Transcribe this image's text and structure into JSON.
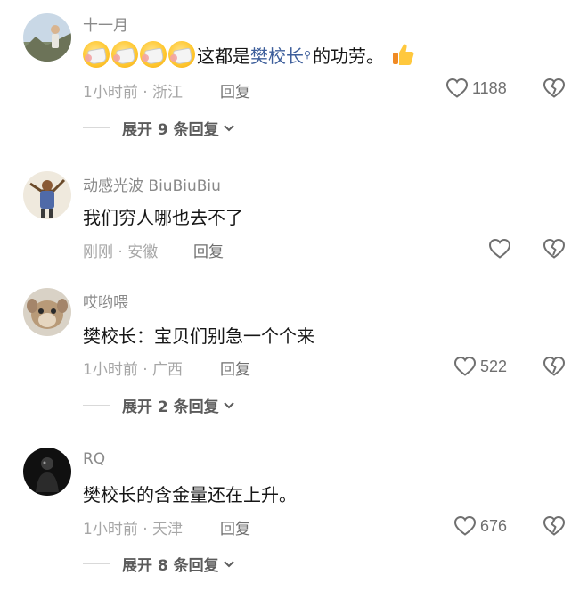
{
  "comments": [
    {
      "username": "十一月",
      "text_prefix": "这都是",
      "link_text": "樊校长",
      "text_suffix": "的功劳。",
      "emoji_icons": [
        "screaming-hug-emoji",
        "screaming-hug-emoji",
        "screaming-hug-emoji",
        "screaming-hug-emoji"
      ],
      "trailing_icon": "thumbs-up-emoji",
      "meta": "1小时前 · 浙江",
      "reply_label": "回复",
      "like_count": "1188",
      "expand_label": "展开 9 条回复"
    },
    {
      "username": "动感光波 BiuBiuBiu",
      "text": "我们穷人哪也去不了",
      "meta": "刚刚 · 安徽",
      "reply_label": "回复",
      "like_count": ""
    },
    {
      "username": "哎哟喂",
      "text": "樊校长：宝贝们别急一个个来",
      "meta": "1小时前 · 广西",
      "reply_label": "回复",
      "like_count": "522",
      "expand_label": "展开 2 条回复"
    },
    {
      "username": "RQ",
      "text": "樊校长的含金量还在上升。",
      "meta": "1小时前 · 天津",
      "reply_label": "回复",
      "like_count": "676",
      "expand_label": "展开 8 条回复"
    }
  ],
  "colors": {
    "username": "#8a8a8a",
    "content": "#161616",
    "link": "#3e5f9b",
    "meta": "#a6a6a6"
  }
}
